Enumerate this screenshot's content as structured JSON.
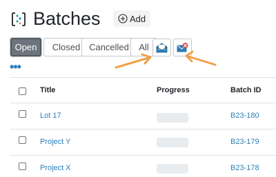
{
  "header": {
    "title": "Batches",
    "add_label": "Add",
    "logo_icon": "batches-icon"
  },
  "filters": [
    {
      "label": "Open",
      "active": true
    },
    {
      "label": "Closed",
      "active": false
    },
    {
      "label": "Cancelled",
      "active": false
    },
    {
      "label": "All",
      "active": false
    }
  ],
  "filter_icons": [
    {
      "icon": "envelope-open-icon",
      "highlighted": true
    },
    {
      "icon": "email-error-icon",
      "highlighted": true
    }
  ],
  "table": {
    "columns": [
      "Title",
      "Progress",
      "Batch ID"
    ],
    "rows": [
      {
        "title": "Lot 17",
        "progress": 0,
        "batch_id": "B23-180"
      },
      {
        "title": "Project Y",
        "progress": 0,
        "batch_id": "B23-179"
      },
      {
        "title": "Project X",
        "progress": 0,
        "batch_id": "B23-178"
      }
    ]
  },
  "colors": {
    "accent": "#2c7fb8",
    "active_filter": "#6c757d",
    "annotation_arrow": "#f0a149"
  }
}
